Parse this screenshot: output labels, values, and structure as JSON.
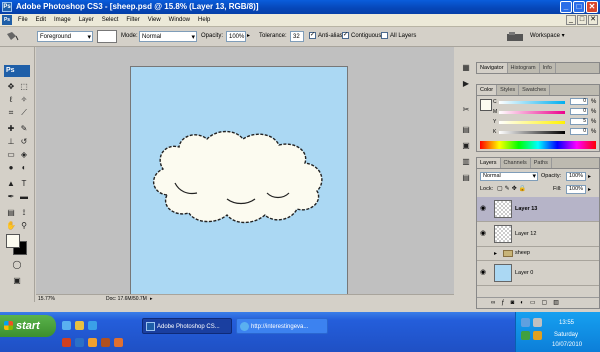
{
  "window": {
    "app_icon": "Ps",
    "title": "Adobe Photoshop CS3 - [sheep.psd @ 15.8% (Layer 13, RGB/8)]",
    "min": "_",
    "max": "□",
    "close": "✕"
  },
  "menu": {
    "items": [
      "File",
      "Edit",
      "Image",
      "Layer",
      "Select",
      "Filter",
      "View",
      "Window",
      "Help"
    ]
  },
  "options": {
    "fill_source": "Foreground",
    "mode_label": "Mode:",
    "mode_value": "Normal",
    "opacity_label": "Opacity:",
    "opacity_value": "100%",
    "tolerance_label": "Tolerance:",
    "tolerance_value": "32",
    "antialias_label": "Anti-alias",
    "contiguous_label": "Contiguous",
    "all_layers_label": "All Layers",
    "workspace_label": "Workspace ▾"
  },
  "toolbox": {
    "logo": "Ps"
  },
  "status": {
    "zoom": "15.77%",
    "doc": "Doc: 17.6M/50.7M"
  },
  "navigator_panel": {
    "tabs": [
      "Navigator",
      "Histogram",
      "Info"
    ]
  },
  "color_panel": {
    "tabs": [
      "Color",
      "Styles",
      "Swatches"
    ],
    "channels": [
      {
        "label": "C",
        "value": "0",
        "unit": "%"
      },
      {
        "label": "M",
        "value": "0",
        "unit": "%"
      },
      {
        "label": "Y",
        "value": "5",
        "unit": "%"
      },
      {
        "label": "K",
        "value": "0",
        "unit": "%"
      }
    ]
  },
  "layers_panel": {
    "tabs": [
      "Layers",
      "Channels",
      "Paths"
    ],
    "blend_mode": "Normal",
    "opacity_label": "Opacity:",
    "opacity_value": "100%",
    "lock_label": "Lock:",
    "fill_label": "Fill:",
    "fill_value": "100%",
    "layers": [
      {
        "name": "Layer 13",
        "selected": true
      },
      {
        "name": "Layer 12",
        "selected": false
      },
      {
        "name": "sheep",
        "selected": false
      },
      {
        "name": "Layer 0",
        "selected": false
      }
    ]
  },
  "taskbar": {
    "start_label": "start",
    "buttons": [
      "Adobe Photoshop CS...",
      "http://interestingeva..."
    ],
    "clock": "13:55",
    "day": "Saturday",
    "date": "10/07/2010"
  },
  "colors": {
    "canvas_bg": "#abd8f3",
    "cloud": "#fcfbf0",
    "title_bar": "#0646b8",
    "taskbar": "#245edb",
    "start_button": "#3c8f2e"
  }
}
